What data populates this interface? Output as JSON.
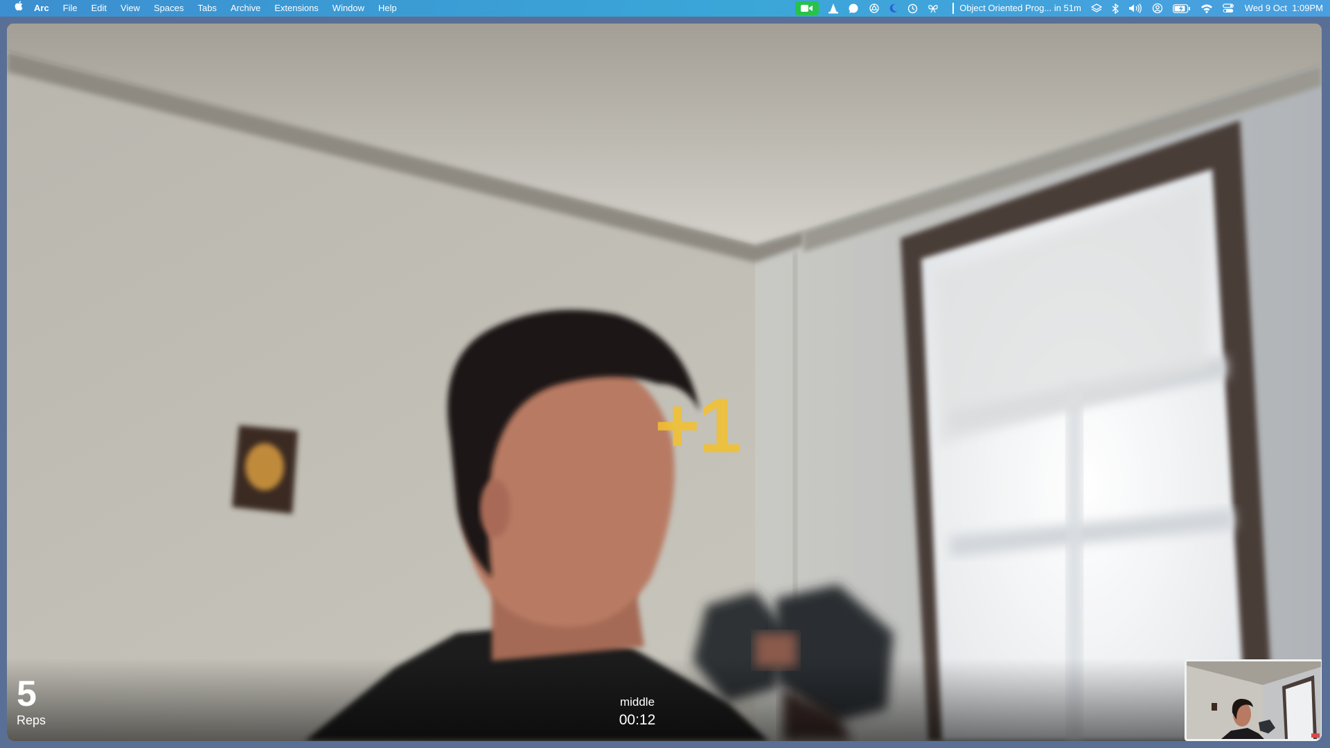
{
  "menubar": {
    "app_name": "Arc",
    "menus": [
      "File",
      "Edit",
      "View",
      "Spaces",
      "Tabs",
      "Archive",
      "Extensions",
      "Window",
      "Help"
    ],
    "status_icons": [
      "facetime-camera-icon",
      "vlc-cone-icon",
      "chat-bubble-icon",
      "openai-icon",
      "moon-icon",
      "clock-icon",
      "butterfly-icon",
      "layers-icon",
      "bluetooth-icon",
      "volume-icon",
      "user-circle-icon",
      "battery-icon",
      "wifi-icon",
      "control-center-icon"
    ],
    "calendar_event": "Object Oriented Prog... in 51m",
    "datetime": "Wed 9 Oct  1:09PM"
  },
  "workout": {
    "rep_count": "5",
    "rep_label": "Reps",
    "phase": "middle",
    "timer": "00:12",
    "rep_feedback": "+1"
  },
  "colors": {
    "feedback_yellow": "#f2c030",
    "facetime_green": "#27c24c",
    "menubar_blue": "#3a9bd6"
  }
}
